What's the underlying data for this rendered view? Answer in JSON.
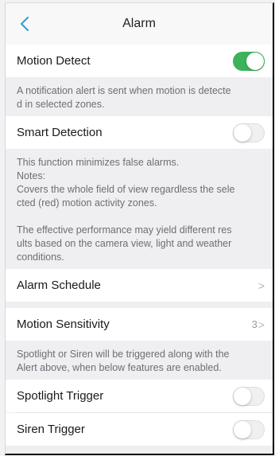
{
  "header": {
    "title": "Alarm"
  },
  "colors": {
    "accent": "#3cb35a",
    "back": "#3aa0d8"
  },
  "motion_detect": {
    "label": "Motion Detect",
    "enabled": true,
    "description": "A notification alert is sent when motion is detecte\nd in selected zones."
  },
  "smart_detection": {
    "label": "Smart Detection",
    "enabled": false,
    "description": "This function minimizes false alarms.\nNotes:\nCovers the whole field of view regardless the sele\ncted (red) motion activity zones.\n\nThe effective performance may yield different res\nults based on the camera view, light and weather\nconditions."
  },
  "alarm_schedule": {
    "label": "Alarm Schedule"
  },
  "motion_sensitivity": {
    "label": "Motion Sensitivity",
    "value": "3"
  },
  "trigger_note": "Spotlight or Siren will be triggered along with the\nAlert above, when below features are enabled.",
  "spotlight_trigger": {
    "label": "Spotlight Trigger",
    "enabled": false
  },
  "siren_trigger": {
    "label": "Siren Trigger",
    "enabled": false
  }
}
